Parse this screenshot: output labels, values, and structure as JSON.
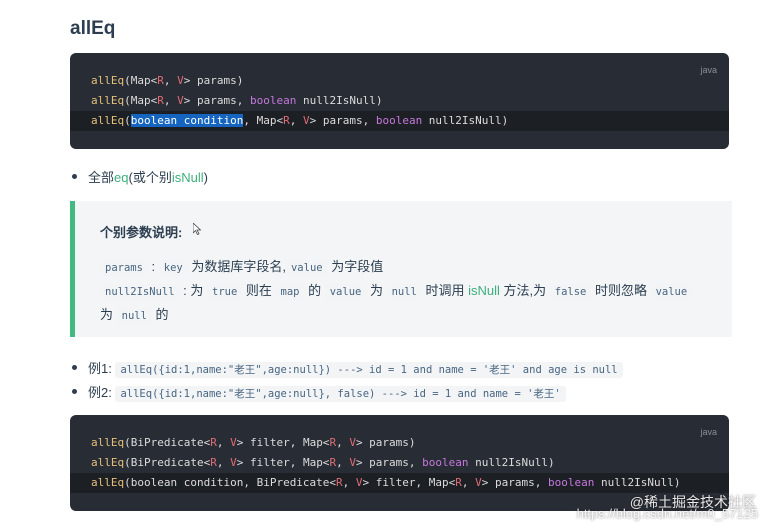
{
  "title": "allEq",
  "code_block_1": {
    "lang": "java",
    "line1": {
      "fn": "allEq",
      "a": "(Map<",
      "t1": "R",
      "b": ", ",
      "t2": "V",
      "c": "> params)"
    },
    "line2": {
      "fn": "allEq",
      "a": "(Map<",
      "t1": "R",
      "b": ", ",
      "t2": "V",
      "c": "> params, ",
      "kw": "boolean",
      "d": " null2IsNull)"
    },
    "line3": {
      "fn": "allEq",
      "open": "(",
      "selected": "boolean condition",
      "a": ", Map<",
      "t1": "R",
      "b": ", ",
      "t2": "V",
      "c": "> params, ",
      "kw": "boolean",
      "d": " null2IsNull)"
    }
  },
  "bullet_main": {
    "pre": "全部",
    "eq": "eq",
    "mid": "(或个别",
    "isnull": "isNull",
    "post": ")"
  },
  "tip": {
    "title": "个别参数说明:",
    "p1": {
      "c1": "params",
      "t1": " : ",
      "c2": "key",
      "t2": " 为数据库字段名,",
      "c3": "value",
      "t3": " 为字段值"
    },
    "p2": {
      "c1": "null2IsNull",
      "t1": " : 为 ",
      "c2": "true",
      "t2": " 则在 ",
      "c3": "map",
      "t3": " 的 ",
      "c4": "value",
      "t4": " 为 ",
      "c5": "null",
      "t5": " 时调用 ",
      "g": "isNull",
      "t6": " 方法,为 ",
      "c6": "false",
      "t7": " 时则忽略 ",
      "c7": "value"
    },
    "p3": {
      "t1": "为 ",
      "c1": "null",
      "t2": " 的"
    }
  },
  "examples": [
    {
      "label": "例1: ",
      "code": "allEq({id:1,name:\"老王\",age:null}) ---> id = 1 and name = '老王' and age is null"
    },
    {
      "label": "例2: ",
      "code": "allEq({id:1,name:\"老王\",age:null}, false) ---> id = 1 and name = '老王'"
    }
  ],
  "code_block_2": {
    "lang": "java",
    "line1": {
      "fn": "allEq",
      "a": "(BiPredicate<",
      "t1": "R",
      "b": ", ",
      "t2": "V",
      "c": "> filter, Map<",
      "t3": "R",
      "d": ", ",
      "t4": "V",
      "e": "> params)"
    },
    "line2": {
      "fn": "allEq",
      "a": "(BiPredicate<",
      "t1": "R",
      "b": ", ",
      "t2": "V",
      "c": "> filter, Map<",
      "t3": "R",
      "d": ", ",
      "t4": "V",
      "e": "> params, ",
      "kw": "boolean",
      "f": " null2IsNull)"
    },
    "line3": {
      "fn": "allEq",
      "a": "(boolean condition, BiPredicate<",
      "t1": "R",
      "b": ", ",
      "t2": "V",
      "c": "> filter, Map<",
      "t3": "R",
      "d": ", ",
      "t4": "V",
      "e": "> params, ",
      "kw": "boolean",
      "f": " null2IsNull)"
    }
  },
  "watermark": {
    "line1": "@稀土掘金技术社区",
    "line2": "https://blog.csdn.net/m0_57125"
  }
}
